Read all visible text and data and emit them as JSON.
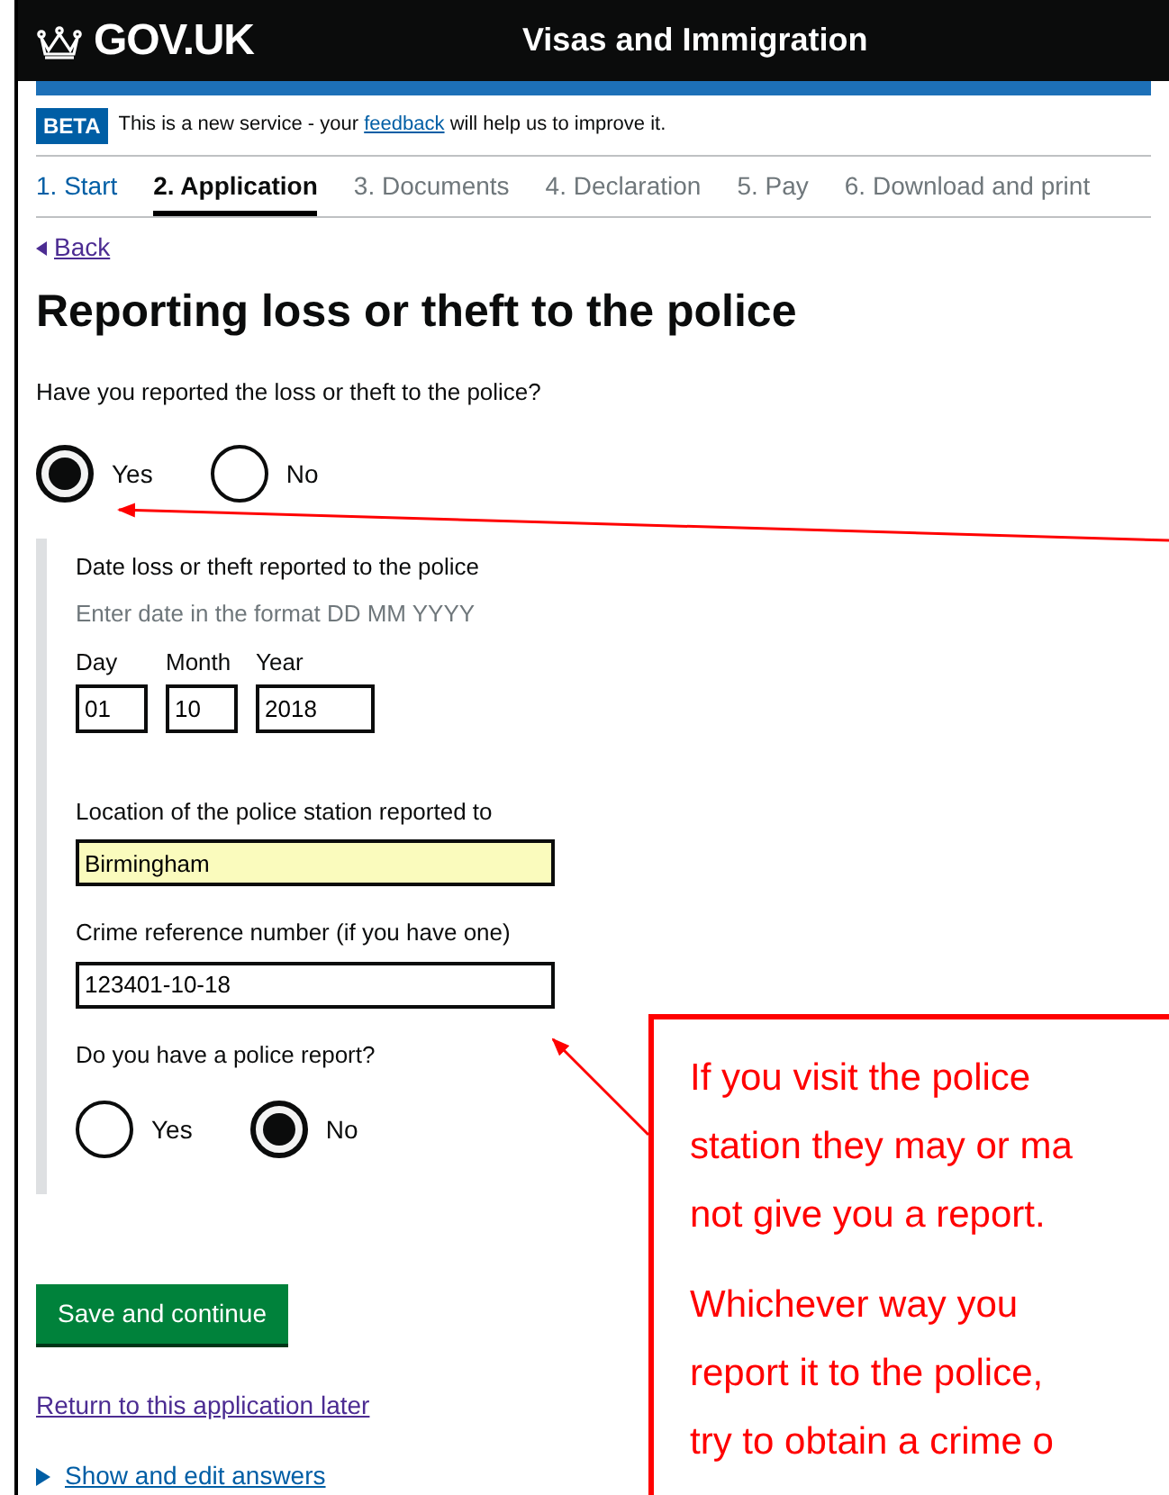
{
  "header": {
    "logo": "GOV.UK",
    "service": "Visas and Immigration"
  },
  "beta": {
    "tag": "BETA",
    "before": "This is a new service - your",
    "link": "feedback",
    "after": "will help us to improve it."
  },
  "steps": [
    {
      "label": "1. Start",
      "completed": true,
      "selected": false
    },
    {
      "label": "2. Application",
      "completed": false,
      "selected": true
    },
    {
      "label": "3. Documents",
      "completed": false,
      "selected": false
    },
    {
      "label": "4. Declaration",
      "completed": false,
      "selected": false
    },
    {
      "label": "5. Pay",
      "completed": false,
      "selected": false
    },
    {
      "label": "6. Download and print",
      "completed": false,
      "selected": false
    }
  ],
  "back": "Back",
  "heading": "Reporting loss or theft to the police",
  "question": "Have you reported the loss or theft to the police?",
  "reported_options": [
    {
      "label": "Yes",
      "selected": true
    },
    {
      "label": "No",
      "selected": false
    }
  ],
  "date": {
    "label": "Date loss or theft reported to the police",
    "hint": "Enter date in the format DD MM YYYY",
    "parts": [
      {
        "label": "Day",
        "value": "01"
      },
      {
        "label": "Month",
        "value": "10"
      },
      {
        "label": "Year",
        "value": "2018"
      }
    ]
  },
  "fields": [
    {
      "label": "Location of the police station reported to",
      "value": "Birmingham",
      "autofilled": true
    },
    {
      "label": "Crime reference number (if you have one)",
      "value": "123401-10-18",
      "autofilled": false
    }
  ],
  "report_question": "Do you have a police report?",
  "report_options": [
    {
      "label": "Yes",
      "selected": false
    },
    {
      "label": "No",
      "selected": true
    }
  ],
  "save_button": "Save and continue",
  "return_link": "Return to this application later",
  "show_answers": "Show and edit answers",
  "callout": {
    "lines": [
      "If you visit the police",
      "station they may or ma",
      "not give you a report.",
      "Whichever way you",
      "report it to the police,",
      "try to obtain a crime o"
    ]
  }
}
